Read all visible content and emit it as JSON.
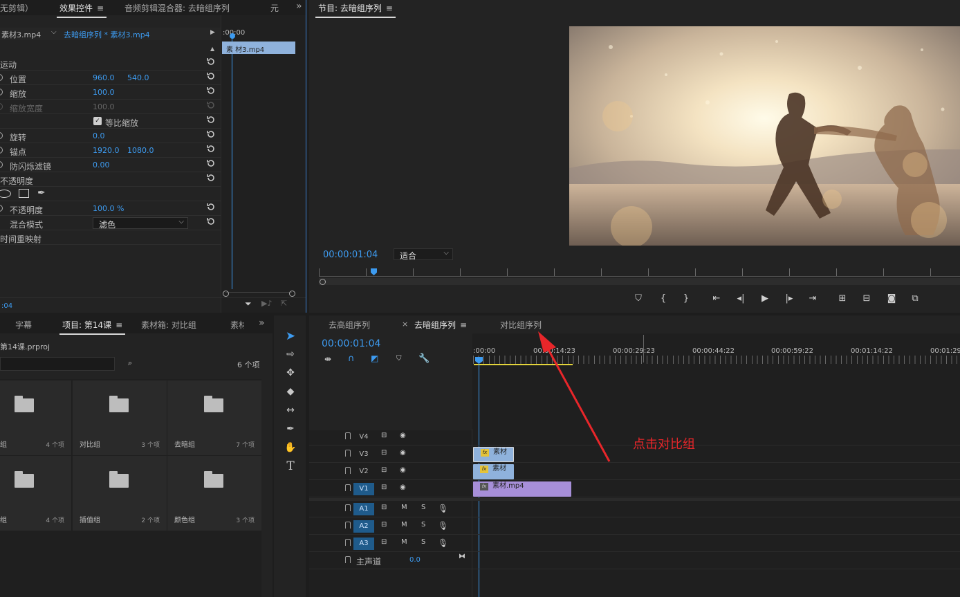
{
  "effect_panel": {
    "tabs": [
      "无剪辑）",
      "效果控件",
      "音频剪辑混合器: 去暗组序列",
      "元"
    ],
    "source_clip": "素材3.mp4",
    "sequence_clip": "去暗组序列 * 素材3.mp4",
    "mini_time": ":00:00",
    "mini_clip": "素 材3.mp4",
    "rows": {
      "motion": "运动",
      "position": "位置",
      "position_x": "960.0",
      "position_y": "540.0",
      "scale": "缩放",
      "scale_val": "100.0",
      "scale_width": "缩放宽度",
      "scale_width_val": "100.0",
      "uniform_scale": "等比缩放",
      "rotation": "旋转",
      "rotation_val": "0.0",
      "anchor": "锚点",
      "anchor_x": "1920.0",
      "anchor_y": "1080.0",
      "flicker": "防闪烁滤镜",
      "flicker_val": "0.00",
      "opacity_group": "不透明度",
      "opacity": "不透明度",
      "opacity_val": "100.0 %",
      "blend": "混合模式",
      "blend_val": "滤色",
      "time_remap": "时间重映射"
    },
    "footer_time": ":04"
  },
  "program": {
    "title": "节目: 去暗组序列",
    "timecode": "00:00:01:04",
    "fit": "适合"
  },
  "project": {
    "tabs": [
      "字幕",
      "项目: 第14课",
      "素材箱: 对比组",
      "素材"
    ],
    "file": "第14课.prproj",
    "item_count": "6 个项",
    "folders": [
      {
        "name": "组",
        "count": "4 个项"
      },
      {
        "name": "对比组",
        "count": "3 个项"
      },
      {
        "name": "去暗组",
        "count": "7 个项"
      },
      {
        "name": "组",
        "count": "4 个项"
      },
      {
        "name": "插值组",
        "count": "2 个项"
      },
      {
        "name": "颜色组",
        "count": "3 个项"
      }
    ]
  },
  "timeline": {
    "tabs": [
      "去高组序列",
      "去暗组序列",
      "对比组序列"
    ],
    "close": "×",
    "timecode": "00:00:01:04",
    "ruler": [
      ":00:00",
      "00:00:14:23",
      "00:00:29:23",
      "00:00:44:22",
      "00:00:59:22",
      "00:01:14:22",
      "00:01:29"
    ],
    "tracks": {
      "v4": "V4",
      "v3": "V3",
      "v2": "V2",
      "v1": "V1",
      "a1": "A1",
      "a2": "A2",
      "a3": "A3",
      "master": "主声道",
      "master_val": "0.0",
      "m": "M",
      "s": "S"
    },
    "clips": {
      "v3": "素材",
      "v2": "素材",
      "v1": "素材.mp4"
    },
    "fx": "fx"
  },
  "annotation": "点击对比组",
  "colors": {
    "accent": "#3d9bf0",
    "annotation": "#e8262a",
    "clip_blue": "#8fb2dc",
    "clip_purple": "#a78fd9"
  }
}
